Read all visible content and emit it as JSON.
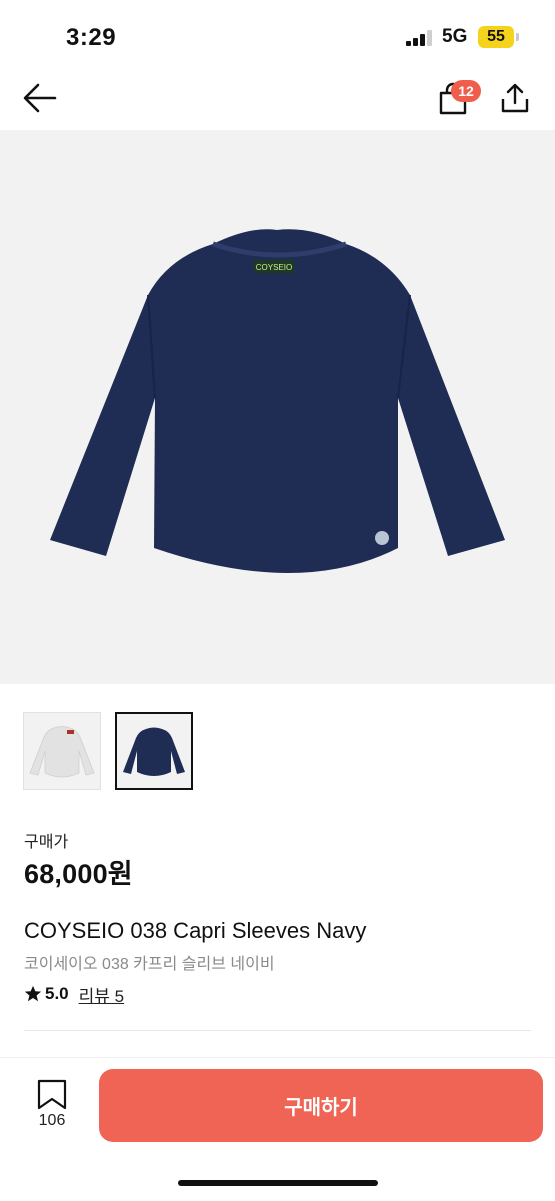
{
  "status_bar": {
    "time": "3:29",
    "network": "5G",
    "battery": "55"
  },
  "nav": {
    "cart_count": "12"
  },
  "product": {
    "brand_label": "COYSEIO",
    "price_label": "구매가",
    "price": "68,000원",
    "title_en": "COYSEIO 038 Capri Sleeves Navy",
    "title_ko": "코이세이오 038 카프리 슬리브 네이비",
    "rating": "5.0",
    "review_text": "리뷰 5"
  },
  "thumbnails": [
    {
      "color": "light gray",
      "selected": false
    },
    {
      "color": "navy",
      "selected": true
    }
  ],
  "bottom_bar": {
    "bookmark_count": "106",
    "buy_label": "구매하기"
  },
  "colors": {
    "accent": "#ef6454",
    "badge": "#ef5d4d",
    "battery": "#f5d31c",
    "garment_navy": "#1f2c54",
    "image_background": "#f2f2f2"
  }
}
